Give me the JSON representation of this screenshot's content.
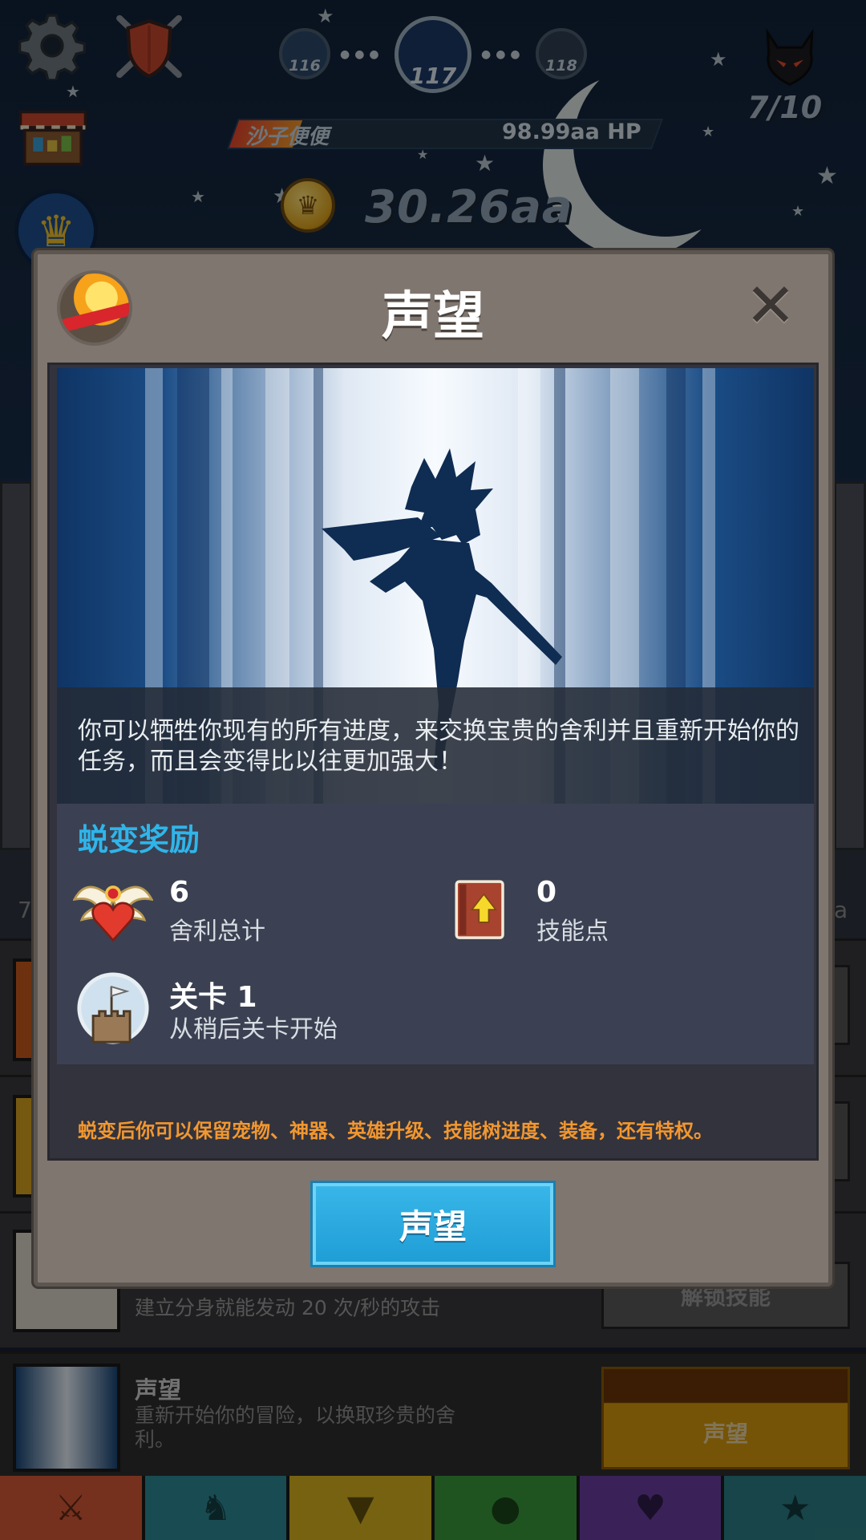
{
  "hud": {
    "stages": {
      "previous": "116",
      "current": "117",
      "next": "118"
    },
    "kills": "7/10",
    "boss": {
      "name": "沙子便便",
      "hp": "98.99aa HP",
      "hp_fraction": 0.15
    },
    "gold": "30.26aa",
    "icons": {
      "settings": "gear-icon",
      "clan": "shield-swords-icon",
      "shop": "shop-icon",
      "crown": "crown-icon",
      "boss": "devil-icon",
      "coin": "crown-coin-icon"
    }
  },
  "background": {
    "partial_left": "7",
    "partial_right": "a",
    "row_skill": {
      "desc": "建立分身就能发动 20 次/秒的攻击",
      "button": "解锁技能"
    },
    "row_prestige": {
      "title": "声望",
      "desc": "重新开始你的冒险，以换取珍贵的舍利。",
      "button": "声望"
    },
    "tabs": [
      {
        "name": "hero",
        "icon": "sword-icon",
        "color": "#d65a35"
      },
      {
        "name": "heroes",
        "icon": "viking-helmet-icon",
        "color": "#2d8a96"
      },
      {
        "name": "equipment",
        "icon": "shirt-icon",
        "color": "#d7b21f"
      },
      {
        "name": "pets",
        "icon": "pet-icon",
        "color": "#3a9a3c"
      },
      {
        "name": "artifacts",
        "icon": "heart-icon",
        "color": "#6b3fa3"
      },
      {
        "name": "shop",
        "icon": "star-icon",
        "color": "#2b7f85"
      }
    ]
  },
  "modal": {
    "title": "声望",
    "close": "✕",
    "description": "你可以牺牲你现有的所有进度，来交换宝贵的舍利并且重新开始你的任务，而且会变得比以往更加强大！",
    "rewards_title": "蜕变奖励",
    "rewards": [
      {
        "value": "6",
        "label": "舍利总计",
        "icon": "winged-heart-icon"
      },
      {
        "value": "0",
        "label": "技能点",
        "icon": "skill-book-icon"
      },
      {
        "value": "关卡 1",
        "label": "从稍后关卡开始",
        "icon": "castle-flag-icon"
      }
    ],
    "keep_note": "蜕变后你可以保留宠物、神器、英雄升级、技能树进度、装备，还有特权。",
    "confirm_button": "声望"
  },
  "colors": {
    "accent_blue": "#2fb5ea",
    "note_orange": "#f2972f",
    "button_blue": "#26a8dd",
    "modal_frame": "#7f766f"
  }
}
